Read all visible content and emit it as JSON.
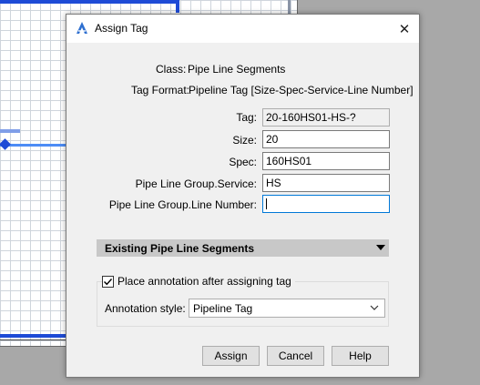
{
  "dialog": {
    "title": "Assign Tag",
    "close_glyph": "✕"
  },
  "info": {
    "class_label": "Class:",
    "class_value": "Pipe Line Segments",
    "tag_format_label": "Tag Format:",
    "tag_format_value": "Pipeline Tag [Size-Spec-Service-Line Number]"
  },
  "fields": {
    "tag": {
      "label": "Tag:",
      "value": "20-160HS01-HS-?"
    },
    "size": {
      "label": "Size:",
      "value": "20"
    },
    "spec": {
      "label": "Spec:",
      "value": "160HS01"
    },
    "service": {
      "label": "Pipe Line Group.Service:",
      "value": "HS"
    },
    "line_number": {
      "label": "Pipe Line Group.Line Number:",
      "value": ""
    }
  },
  "section": {
    "title": "Existing Pipe Line Segments"
  },
  "annotation": {
    "checkbox_label": "Place annotation after assigning tag",
    "checked": true,
    "style_label": "Annotation style:",
    "style_value": "Pipeline Tag"
  },
  "buttons": {
    "assign": "Assign",
    "cancel": "Cancel",
    "help": "Help"
  },
  "colors": {
    "canvas_frame": "#1e4bd6",
    "pipe": "#4c8cf5",
    "focus_border": "#0078d7",
    "app_icon": "#2e6fd0"
  },
  "icons": [
    "autocad-app-icon",
    "close-icon",
    "dropdown-arrow-icon",
    "chevron-down-icon",
    "checkmark-icon"
  ]
}
